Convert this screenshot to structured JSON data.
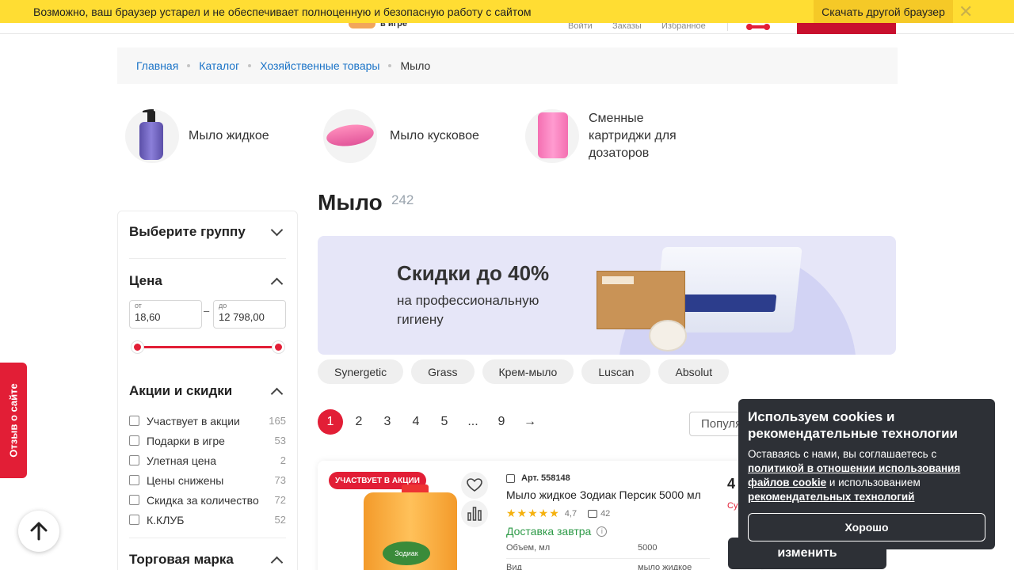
{
  "outdated_bar": {
    "message": "Возможно, ваш браузер устарел и не обеспечивает полноценную и безопасную работу с сайтом",
    "button": "Скачать другой браузер",
    "close": "✕"
  },
  "header": {
    "logo_text": "в игре",
    "nav": [
      "Войти",
      "Заказы",
      "Избранное"
    ]
  },
  "breadcrumbs": [
    "Главная",
    "Каталог",
    "Хозяйственные товары",
    "Мыло"
  ],
  "subcategories": [
    {
      "label": "Мыло жидкое"
    },
    {
      "label": "Мыло кусковое"
    },
    {
      "label": "Сменные картриджи для дозаторов"
    }
  ],
  "page": {
    "title": "Мыло",
    "count": "242"
  },
  "banner": {
    "title": "Скидки до 40%",
    "subtitle": "на профессиональную гигиену"
  },
  "chips": [
    "Synergetic",
    "Grass",
    "Крем-мыло",
    "Luscan",
    "Absolut"
  ],
  "pagination": {
    "pages": [
      "1",
      "2",
      "3",
      "4",
      "5",
      "...",
      "9"
    ],
    "next": "→",
    "current": "1"
  },
  "sort": {
    "label": "Популярные"
  },
  "filters": {
    "group_title": "Выберите группу",
    "price_title": "Цена",
    "price_from_caption": "от",
    "price_to_caption": "до",
    "price_from": "18,60",
    "price_to": "12 798,00",
    "price_separator": "–",
    "promo_title": "Акции и скидки",
    "promo_items": [
      {
        "label": "Участвует в акции",
        "count": "165"
      },
      {
        "label": "Подарки в игре",
        "count": "53"
      },
      {
        "label": "Улетная цена",
        "count": "2"
      },
      {
        "label": "Цены снижены",
        "count": "73"
      },
      {
        "label": "Скидка за количество",
        "count": "72"
      },
      {
        "label": "К.КЛУБ",
        "count": "52"
      }
    ],
    "brand_title": "Торговая марка"
  },
  "feedback_tab": "Отзыв о сайте",
  "product": {
    "badge": "УЧАСТВУЕТ В АКЦИИ",
    "sku": "Арт. 558148",
    "name": "Мыло жидкое Зодиак Персик 5000 мл",
    "rating": "4,7",
    "reviews": "42",
    "delivery": "Доставка завтра",
    "props": [
      {
        "key": "Объем, мл",
        "value": "5000"
      },
      {
        "key": "Вид",
        "value": "мыло жидкое"
      }
    ],
    "image_label": "Зодиак",
    "price_partial": "4",
    "price_note": "Су",
    "change_button": "изменить"
  },
  "cookie": {
    "title": "Используем cookies и рекомендательные технологии",
    "text_1": "Оставаясь с нами, вы соглашаетесь с ",
    "link_1": "политикой в отношении использования файлов cookie",
    "text_2": " и использованием ",
    "link_2": "рекомендательных технологий",
    "ok": "Хорошо"
  },
  "icons": {
    "close": "close-icon",
    "heart": "heart-icon",
    "compare": "compare-icon",
    "arrow_up": "arrow-up-icon",
    "copy": "copy-icon",
    "review": "review-icon",
    "info": "info-icon"
  },
  "colors": {
    "accent": "#e21e36",
    "outdated_bg": "#ffdd33",
    "link": "#1a73c7",
    "delivery": "#2d9a47",
    "dark": "#2d3036"
  }
}
